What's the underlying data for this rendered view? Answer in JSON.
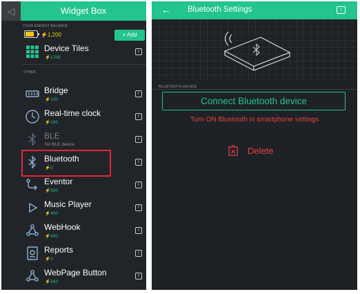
{
  "widget_box": {
    "back_glyph": "◁",
    "title": "Widget Box",
    "energy_label": "YOUR ENERGY BALANCE",
    "energy_value": "⚡1,200",
    "energy_level_percent": 75,
    "add_label": "+ Add",
    "other_label": "OTHER",
    "info_glyph": "i",
    "items": [
      {
        "name": "Device Tiles",
        "price": "⚡1700",
        "icon": "tiles-icon"
      },
      {
        "name": "Bridge",
        "price": "⚡100",
        "icon": "bridge-icon"
      },
      {
        "name": "Real-time clock",
        "price": "⚡100",
        "icon": "clock-icon"
      },
      {
        "name": "BLE",
        "price": "No BLE device",
        "icon": "ble-icon"
      },
      {
        "name": "Bluetooth",
        "price": "⚡0",
        "icon": "bluetooth-icon"
      },
      {
        "name": "Eventor",
        "price": "⚡500",
        "icon": "eventor-icon"
      },
      {
        "name": "Music Player",
        "price": "⚡400",
        "icon": "play-icon"
      },
      {
        "name": "WebHook",
        "price": "⚡500",
        "icon": "webhook-icon"
      },
      {
        "name": "Reports",
        "price": "⚡0",
        "icon": "reports-icon"
      },
      {
        "name": "WebPage Button",
        "price": "⚡500",
        "icon": "webhook-icon"
      }
    ]
  },
  "bluetooth_settings": {
    "back_glyph": "←",
    "title": "Bluetooth Settings",
    "info_glyph": "i",
    "section_label": "BLUETOOTH DEVICE",
    "connect_label": "Connect Bluetooth device",
    "warning": "Turn ON Bluetooth in smartphone settings",
    "delete_label": "Delete"
  },
  "colors": {
    "accent": "#23c48e",
    "background": "#212428",
    "warning": "#e64343",
    "highlight": "#e32636",
    "energy": "#f0c419"
  }
}
